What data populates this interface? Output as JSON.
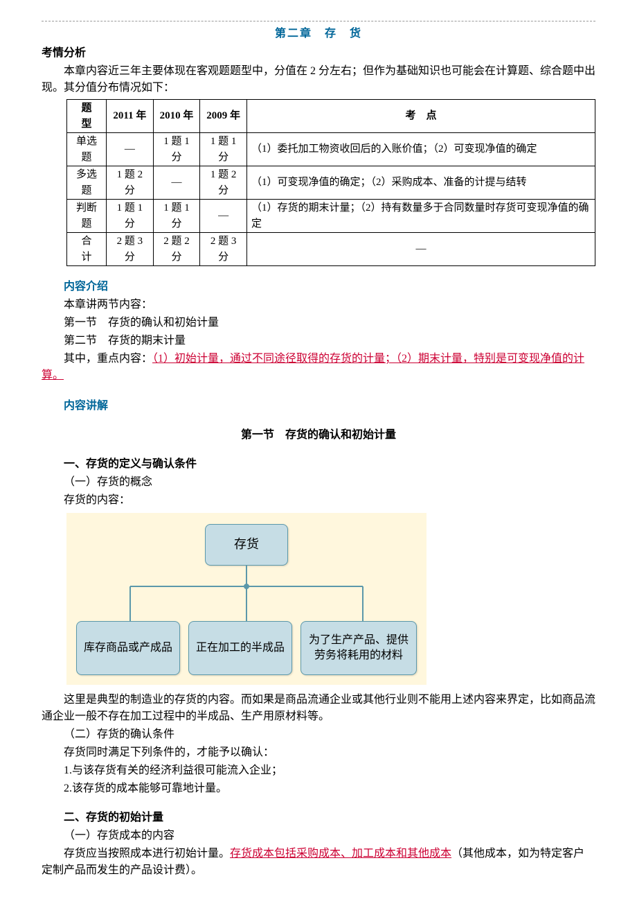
{
  "chapterTitle": "第二章　存　货",
  "analysisHeading": "考情分析",
  "analysisPara": "本章内容近三年主要体现在客观题题型中，分值在 2 分左右；但作为基础知识也可能会在计算题、综合题中出现。其分值分布情况如下：",
  "table": {
    "headers": [
      "题　型",
      "2011 年",
      "2010 年",
      "2009 年",
      "考　点"
    ],
    "rows": [
      {
        "type": "单选题",
        "y2011": "—",
        "y2010": "1 题 1 分",
        "y2009": "1 题 1 分",
        "note": "（1）委托加工物资收回后的入账价值；（2）可变现净值的确定"
      },
      {
        "type": "多选题",
        "y2011": "1 题 2 分",
        "y2010": "—",
        "y2009": "1 题 2 分",
        "note": "（1）可变现净值的确定；（2）采购成本、准备的计提与结转"
      },
      {
        "type": "判断题",
        "y2011": "1 题 1 分",
        "y2010": "1 题 1 分",
        "y2009": "—",
        "note": "（1）存货的期末计量；（2）持有数量多于合同数量时存货可变现净值的确定"
      },
      {
        "type": "合　计",
        "y2011": "2 题 3 分",
        "y2010": "2 题 2 分",
        "y2009": "2 题 3 分",
        "note": "—"
      }
    ]
  },
  "introHeading": "内容介绍",
  "introLine1": "本章讲两节内容：",
  "introLine2": "第一节　存货的确认和初始计量",
  "introLine3": "第二节　存货的期末计量",
  "introLead": "其中，重点内容：",
  "introKey": "（1）初始计量，通过不同途径取得的存货的计量；（2）期末计量，特别是可变现净值的计算。",
  "lectureHeading": "内容讲解",
  "section1Title": "第一节　存货的确认和初始计量",
  "h1": "一、存货的定义与确认条件",
  "h1a": "（一）存货的概念",
  "h1aLine": "存货的内容：",
  "diagram": {
    "root": "存货",
    "children": [
      "库存商品或产成品",
      "正在加工的半成品",
      "为了生产产品、提供劳务将耗用的材料"
    ]
  },
  "afterDiagram": "这里是典型的制造业的存货的内容。而如果是商品流通企业或其他行业则不能用上述内容来界定，比如商品流通企业一般不存在加工过程中的半成品、生产用原材料等。",
  "h1b": "（二）存货的确认条件",
  "h1bLine": "存货同时满足下列条件的，才能予以确认：",
  "h1bItem1": "1.与该存货有关的经济利益很可能流入企业；",
  "h1bItem2": "2.该存货的成本能够可靠地计量。",
  "h2": "二、存货的初始计量",
  "h2a": "（一）存货成本的内容",
  "h2aLead": "存货应当按照成本进行初始计量。",
  "h2aKey": "存货成本包括采购成本、加工成本和其他成本",
  "h2aTail": "（其他成本，如为特定客户定制产品而发生的产品设计费）。"
}
